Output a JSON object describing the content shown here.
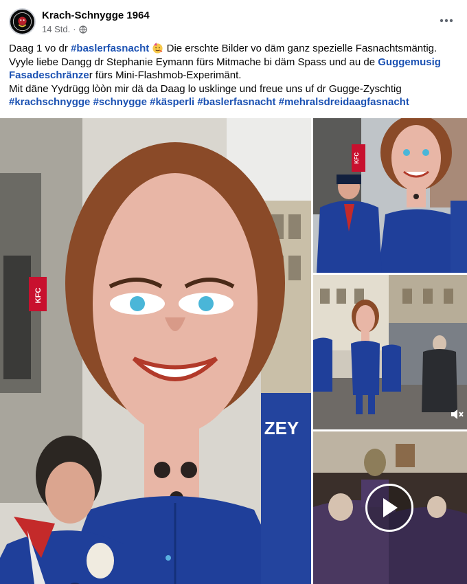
{
  "post": {
    "page_name": "Krach-Schnygge 1964",
    "timestamp": "14 Std.",
    "separator": "·",
    "privacy_icon": "globe-icon",
    "more_icon": "more-options-icon"
  },
  "caption": {
    "l1_a": "Daag 1 vo dr ",
    "tag_baslerfasnacht_1": "#baslerfasnacht",
    "emoji": "partying-face-emoji",
    "l1_b": " Die erschte Bilder vo däm ganz spezielle Fasnachtsmäntig. Vyyle liebe Dangg dr Stephanie Eymann fürs Mitmache bi däm Spass und au de ",
    "link_guggemusig": "Guggemusig Fasadeschränze",
    "l1_c": "r fürs Mini-Flashmob-Experimänt.",
    "l2": "Mit däne Yydrügg lòòn mir dä da Daag lo usklinge und freue uns uf dr Gugge-Zyschtig",
    "tags": [
      "#krachschnygge",
      "#schnygge",
      "#käsperli",
      "#baslerfasnacht",
      "#mehralsdreidaagfasnacht"
    ]
  },
  "media": {
    "main_photo": {
      "sign_kfc": "KFC",
      "jacket_text": "ZEY"
    },
    "photo_2": {
      "sign_kfc": "KFC"
    },
    "photo_3": {},
    "video": {
      "play_icon": "play-icon"
    },
    "mute_icon": "speaker-muted-icon"
  },
  "colors": {
    "link": "#1c52b3",
    "secondary_text": "#65676b",
    "jacket_blue": "#1f3f9a",
    "kfc_red": "#c8102e"
  }
}
